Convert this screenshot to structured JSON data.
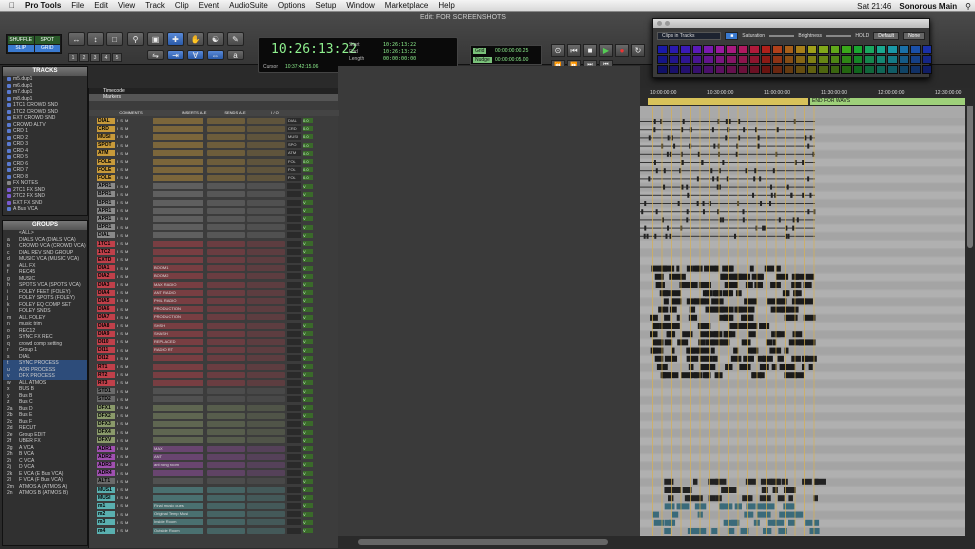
{
  "menubar": {
    "apple": "",
    "app": "Pro Tools",
    "items": [
      "File",
      "Edit",
      "View",
      "Track",
      "Clip",
      "Event",
      "AudioSuite",
      "Options",
      "Setup",
      "Window",
      "Marketplace",
      "Help"
    ],
    "clock": "Sat 21:46",
    "user": "Sonorous Main"
  },
  "window": {
    "title": "Edit: FOR SCREENSHOTS"
  },
  "modes": {
    "shuffle": "SHUFFLE",
    "spot": "SPOT",
    "slip": "SLIP",
    "grid": "GRID"
  },
  "zoom_presets": [
    "1",
    "2",
    "3",
    "4",
    "5"
  ],
  "counter": {
    "main": "10:26:13:22",
    "start_label": "Start",
    "end_label": "End",
    "length_label": "Length",
    "start": "10:26:13:22",
    "end": "10:26:13:22",
    "length": "00:00:00:00",
    "cursor_label": "Cursor",
    "cursor": "10:37:42:15.06"
  },
  "grid": {
    "grid_label": "Grid",
    "nudge_label": "Nudge",
    "grid_value": "00:00:00:00.25",
    "nudge_value": "00:00:00:05.00"
  },
  "palette": {
    "dropdown": "Clips in Tracks",
    "saturation": "Saturation",
    "brightness": "Brightness",
    "hold": "HOLD",
    "default": "Default",
    "none": "None",
    "colors": [
      "#1a1aa8",
      "#2a1ab0",
      "#3a1ab8",
      "#5a1ab8",
      "#7a1ab0",
      "#9a1aa0",
      "#a81a80",
      "#b01a60",
      "#b01a3a",
      "#b0201a",
      "#b0401a",
      "#a8601a",
      "#a8801a",
      "#a0a01a",
      "#80a81a",
      "#60a81a",
      "#3aa81a",
      "#1aa830",
      "#1aa860",
      "#1aa890",
      "#1a98a8",
      "#1a70a8",
      "#1a50a8",
      "#1a30a8"
    ],
    "rows": 3
  },
  "tracks_panel": {
    "title": "TRACKS",
    "items": [
      "m5.dup1",
      "m6.dup1",
      "m7.dup1",
      "m8.dup1",
      "1TC1 CROWD SND",
      "1TC2 CROWD SND",
      "EXT CROWD SND",
      "CROWD ALTV",
      "CRD 1",
      "CRD 2",
      "CRD 3",
      "CRD 4",
      "CRD 5",
      "CRD 6",
      "CRD 7",
      "CRD 8",
      "FX NOTES",
      "2TC1 FX SND",
      "2TC2 FX SND",
      "EXT FX SND",
      "A Bus VCA"
    ],
    "colors": [
      "#5a7ad0",
      "#5a7ad0",
      "#5a7ad0",
      "#5a7ad0",
      "#5a7ad0",
      "#5a7ad0",
      "#5a7ad0",
      "#5a7ad0",
      "#5a7ad0",
      "#5a7ad0",
      "#5a7ad0",
      "#5a7ad0",
      "#5a7ad0",
      "#5a7ad0",
      "#5a7ad0",
      "#5a7ad0",
      "#888888",
      "#7a5ad0",
      "#7a5ad0",
      "#7a5ad0",
      "#5a7ad0"
    ]
  },
  "groups_panel": {
    "title": "GROUPS",
    "items": [
      "<ALL>",
      "DIALS VCA (DIALS VCA)",
      "CROWD VCA (CROWD VCA)",
      "DIAL REV SND GROUP",
      "MUSIC VCA (MUSIC VCA)",
      "ALL FX",
      "REC45",
      "MUSIC",
      "SPOTS VCA (SPOTS VCA)",
      "FOLEY FEET (FOLEY)",
      "FOLEY SPOTS (FOLEY)",
      "FOLEY EQ COMP SET",
      "FOLEY SNDS",
      "ALL FOLEY",
      "music trim",
      "REC12",
      "SYNC FX REC",
      "crowd comp setting",
      "Group 1",
      "DIAL",
      "SYNC PROCESS",
      "ADR PROCESS",
      "DFX PROCESS",
      "ALL ATMOS",
      "BUS B",
      "Bus B",
      "Bus C",
      "Bus D",
      "Bus E",
      "Bus F",
      "RECUT",
      "Group EDIT",
      "UBER FX",
      "A VCA",
      "B VCA",
      "C VCA",
      "D VCA",
      "E VCA (E Bus VCA)",
      "F VCA (F Bus VCA)",
      "ATMOS A (ATMOS A)",
      "ATMOS B (ATMOS B)"
    ],
    "prefixes": [
      "",
      "a",
      "b",
      "c",
      "d",
      "e",
      "f",
      "g",
      "h",
      "i",
      "j",
      "k",
      "l",
      "m",
      "n",
      "o",
      "p",
      "q",
      "r",
      "s",
      "t",
      "u",
      "v",
      "w",
      "x",
      "y",
      "z",
      "2a",
      "2b",
      "2c",
      "2d",
      "2e",
      "2f",
      "2g",
      "2h",
      "2i",
      "2j",
      "2k",
      "2l",
      "2m",
      "2n"
    ],
    "highlighted": [
      20,
      21,
      22
    ]
  },
  "mix": {
    "timecode_label": "Timecode",
    "markers_label": "Markers",
    "col_comments": "COMMENTS",
    "col_inserts": "INSERTS A-E",
    "col_sends": "SENDS A-E",
    "col_io": "I / O",
    "tracks": [
      {
        "name": "DIAL",
        "color": "#c89a3a",
        "comment": "",
        "io": "DIAL",
        "vol": "0.0"
      },
      {
        "name": "CRD",
        "color": "#c89a3a",
        "comment": "",
        "io": "CRD",
        "vol": "0.0"
      },
      {
        "name": "MUSI",
        "color": "#c89a3a",
        "comment": "",
        "io": "MUSI",
        "vol": "0.0"
      },
      {
        "name": "SPOT",
        "color": "#c89a3a",
        "comment": "",
        "io": "SPO",
        "vol": "0.0"
      },
      {
        "name": "ATM",
        "color": "#c89a3a",
        "comment": "",
        "io": "ATM",
        "vol": "0.0"
      },
      {
        "name": "FOLE",
        "color": "#c89a3a",
        "comment": "",
        "io": "FOL",
        "vol": "0.0"
      },
      {
        "name": "FOLE",
        "color": "#c89a3a",
        "comment": "",
        "io": "FOL",
        "vol": "0.0"
      },
      {
        "name": "FOLE",
        "color": "#c89a3a",
        "comment": "",
        "io": "FOL",
        "vol": "0.0"
      },
      {
        "name": "APR1",
        "color": "#8a8a8a",
        "comment": "",
        "io": "",
        "vol": "V"
      },
      {
        "name": "BPR1",
        "color": "#8a8a8a",
        "comment": "",
        "io": "",
        "vol": "V"
      },
      {
        "name": "BPR1",
        "color": "#8a8a8a",
        "comment": "",
        "io": "",
        "vol": "V"
      },
      {
        "name": "APR1",
        "color": "#8a8a8a",
        "comment": "",
        "io": "",
        "vol": "V"
      },
      {
        "name": "APR1",
        "color": "#8a8a8a",
        "comment": "",
        "io": "",
        "vol": "V"
      },
      {
        "name": "BPR1",
        "color": "#8a8a8a",
        "comment": "",
        "io": "",
        "vol": "V"
      },
      {
        "name": "DIAL",
        "color": "#8a8a8a",
        "comment": "",
        "io": "",
        "vol": "V"
      },
      {
        "name": "1TC1",
        "color": "#c0404a",
        "comment": "",
        "io": "",
        "vol": "V"
      },
      {
        "name": "1TC2",
        "color": "#c0404a",
        "comment": "",
        "io": "",
        "vol": "V"
      },
      {
        "name": "EXTD",
        "color": "#c0404a",
        "comment": "",
        "io": "",
        "vol": "V"
      },
      {
        "name": "DIA1",
        "color": "#c0404a",
        "comment": "BOOM1",
        "io": "",
        "vol": "V"
      },
      {
        "name": "DIA2",
        "color": "#c0404a",
        "comment": "BOOM2",
        "io": "",
        "vol": "V"
      },
      {
        "name": "DIA3",
        "color": "#c0404a",
        "comment": "MAX RADIO",
        "io": "",
        "vol": "V"
      },
      {
        "name": "DIA4",
        "color": "#c0404a",
        "comment": "ANT RADIO",
        "io": "",
        "vol": "V"
      },
      {
        "name": "DIA5",
        "color": "#c0404a",
        "comment": "PHIL RADIO",
        "io": "",
        "vol": "V"
      },
      {
        "name": "DIA6",
        "color": "#c0404a",
        "comment": "PRODUCTION",
        "io": "",
        "vol": "V"
      },
      {
        "name": "DIA7",
        "color": "#c0404a",
        "comment": "PRODUCTION",
        "io": "",
        "vol": "V"
      },
      {
        "name": "DIA8",
        "color": "#c0404a",
        "comment": "SHSH",
        "io": "",
        "vol": "V"
      },
      {
        "name": "DIA9",
        "color": "#c0404a",
        "comment": "SHASH",
        "io": "",
        "vol": "V"
      },
      {
        "name": "DI10",
        "color": "#c0404a",
        "comment": "REPLACED",
        "io": "",
        "vol": "V"
      },
      {
        "name": "DI11",
        "color": "#c0404a",
        "comment": "RADIO RT",
        "io": "",
        "vol": "V"
      },
      {
        "name": "DI12",
        "color": "#c0404a",
        "comment": "",
        "io": "",
        "vol": "V"
      },
      {
        "name": "RT1",
        "color": "#c0404a",
        "comment": "",
        "io": "",
        "vol": "V"
      },
      {
        "name": "RT2",
        "color": "#c0404a",
        "comment": "",
        "io": "",
        "vol": "V"
      },
      {
        "name": "RT3",
        "color": "#c0404a",
        "comment": "",
        "io": "",
        "vol": "V"
      },
      {
        "name": "STD1",
        "color": "#6a6a6a",
        "comment": "",
        "io": "",
        "vol": "V"
      },
      {
        "name": "STD2",
        "color": "#6a6a6a",
        "comment": "",
        "io": "",
        "vol": "V"
      },
      {
        "name": "DFX1",
        "color": "#8a9a6a",
        "comment": "",
        "io": "",
        "vol": "V"
      },
      {
        "name": "DFX2",
        "color": "#8a9a6a",
        "comment": "",
        "io": "",
        "vol": "V"
      },
      {
        "name": "DFX3",
        "color": "#8a9a6a",
        "comment": "",
        "io": "",
        "vol": "V"
      },
      {
        "name": "DFX4",
        "color": "#8a9a6a",
        "comment": "",
        "io": "",
        "vol": "V"
      },
      {
        "name": "DFXV",
        "color": "#8a9a6a",
        "comment": "",
        "io": "",
        "vol": "V"
      },
      {
        "name": "ADR1",
        "color": "#a050b0",
        "comment": "MAX",
        "io": "",
        "vol": "V"
      },
      {
        "name": "ADR2",
        "color": "#a050b0",
        "comment": "ANT",
        "io": "",
        "vol": "V"
      },
      {
        "name": "ADR3",
        "color": "#a050b0",
        "comment": "ant rong room",
        "io": "",
        "vol": "V"
      },
      {
        "name": "ADR4",
        "color": "#a050b0",
        "comment": "",
        "io": "",
        "vol": "V"
      },
      {
        "name": "ALT1",
        "color": "#6a6a6a",
        "comment": "",
        "io": "",
        "vol": "V"
      },
      {
        "name": "MUS1",
        "color": "#5ab0b0",
        "comment": "",
        "io": "",
        "vol": "V"
      },
      {
        "name": "MUSI",
        "color": "#5ab0b0",
        "comment": "",
        "io": "",
        "vol": "V"
      },
      {
        "name": "m1",
        "color": "#5ab0b0",
        "comment": "Final music cues",
        "io": "",
        "vol": "V"
      },
      {
        "name": "m2",
        "color": "#5ab0b0",
        "comment": "Original Temp Musi",
        "io": "",
        "vol": "V"
      },
      {
        "name": "m3",
        "color": "#5ab0b0",
        "comment": "Inside Room",
        "io": "",
        "vol": "V"
      },
      {
        "name": "m4",
        "color": "#5ab0b0",
        "comment": "Outside Room",
        "io": "",
        "vol": "V"
      }
    ]
  },
  "ruler": {
    "ticks": [
      "10:00:00:00",
      "10:30:00:00",
      "11:00:00:00",
      "11:30:00:00",
      "12:00:00:00",
      "12:30:00:00"
    ],
    "marker_label": "END FOR WAVS"
  },
  "buttons": {
    "solo_mute": "I S M",
    "vol_label": "0.0"
  }
}
